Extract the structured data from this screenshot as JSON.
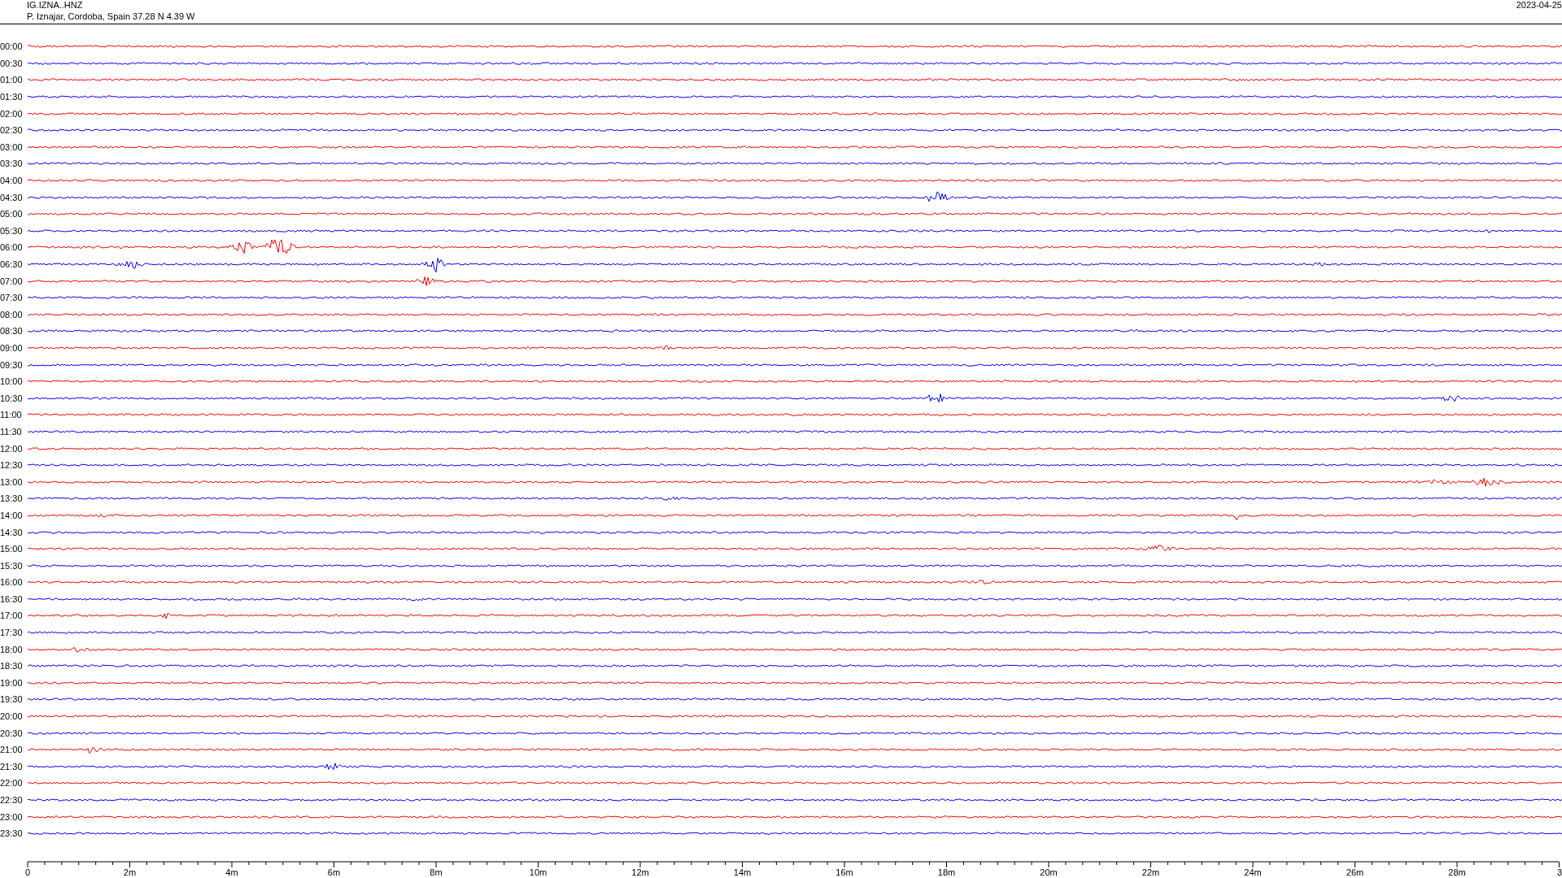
{
  "header": {
    "station": "IG.IZNA..HNZ",
    "location": "P. Iznajar, Cordoba, Spain  37.28 N 4.39 W",
    "date": "2023-04-25"
  },
  "rows": [
    {
      "label": "00:00",
      "color": "#ff0000"
    },
    {
      "label": "00:30",
      "color": "#0000ff"
    },
    {
      "label": "01:00",
      "color": "#ff0000"
    },
    {
      "label": "01:30",
      "color": "#0000ff"
    },
    {
      "label": "02:00",
      "color": "#ff0000"
    },
    {
      "label": "02:30",
      "color": "#0000ff"
    },
    {
      "label": "03:00",
      "color": "#ff0000"
    },
    {
      "label": "03:30",
      "color": "#0000ff"
    },
    {
      "label": "04:00",
      "color": "#ff0000"
    },
    {
      "label": "04:30",
      "color": "#0000ff"
    },
    {
      "label": "05:00",
      "color": "#ff0000"
    },
    {
      "label": "05:30",
      "color": "#0000ff"
    },
    {
      "label": "06:00",
      "color": "#ff0000"
    },
    {
      "label": "06:30",
      "color": "#0000ff"
    },
    {
      "label": "07:00",
      "color": "#ff0000"
    },
    {
      "label": "07:30",
      "color": "#0000ff"
    },
    {
      "label": "08:00",
      "color": "#ff0000"
    },
    {
      "label": "08:30",
      "color": "#0000ff"
    },
    {
      "label": "09:00",
      "color": "#ff0000"
    },
    {
      "label": "09:30",
      "color": "#0000ff"
    },
    {
      "label": "10:00",
      "color": "#ff0000"
    },
    {
      "label": "10:30",
      "color": "#0000ff"
    },
    {
      "label": "11:00",
      "color": "#ff0000"
    },
    {
      "label": "11:30",
      "color": "#0000ff"
    },
    {
      "label": "12:00",
      "color": "#ff0000"
    },
    {
      "label": "12:30",
      "color": "#0000ff"
    },
    {
      "label": "13:00",
      "color": "#ff0000"
    },
    {
      "label": "13:30",
      "color": "#0000ff"
    },
    {
      "label": "14:00",
      "color": "#ff0000"
    },
    {
      "label": "14:30",
      "color": "#0000ff"
    },
    {
      "label": "15:00",
      "color": "#ff0000"
    },
    {
      "label": "15:30",
      "color": "#0000ff"
    },
    {
      "label": "16:00",
      "color": "#ff0000"
    },
    {
      "label": "16:30",
      "color": "#0000ff"
    },
    {
      "label": "17:00",
      "color": "#ff0000"
    },
    {
      "label": "17:30",
      "color": "#0000ff"
    },
    {
      "label": "18:00",
      "color": "#ff0000"
    },
    {
      "label": "18:30",
      "color": "#0000ff"
    },
    {
      "label": "19:00",
      "color": "#ff0000"
    },
    {
      "label": "19:30",
      "color": "#0000ff"
    },
    {
      "label": "20:00",
      "color": "#ff0000"
    },
    {
      "label": "20:30",
      "color": "#0000ff"
    },
    {
      "label": "21:00",
      "color": "#ff0000"
    },
    {
      "label": "21:30",
      "color": "#0000ff"
    },
    {
      "label": "22:00",
      "color": "#ff0000"
    },
    {
      "label": "22:30",
      "color": "#0000ff"
    },
    {
      "label": "23:00",
      "color": "#ff0000"
    },
    {
      "label": "23:30",
      "color": "#0000ff"
    }
  ],
  "x_axis": {
    "ticks": [
      "0",
      "2m",
      "4m",
      "6m",
      "8m",
      "10m",
      "12m",
      "14m",
      "16m",
      "18m",
      "20m",
      "22m",
      "24m",
      "26m",
      "28m",
      "3"
    ]
  }
}
